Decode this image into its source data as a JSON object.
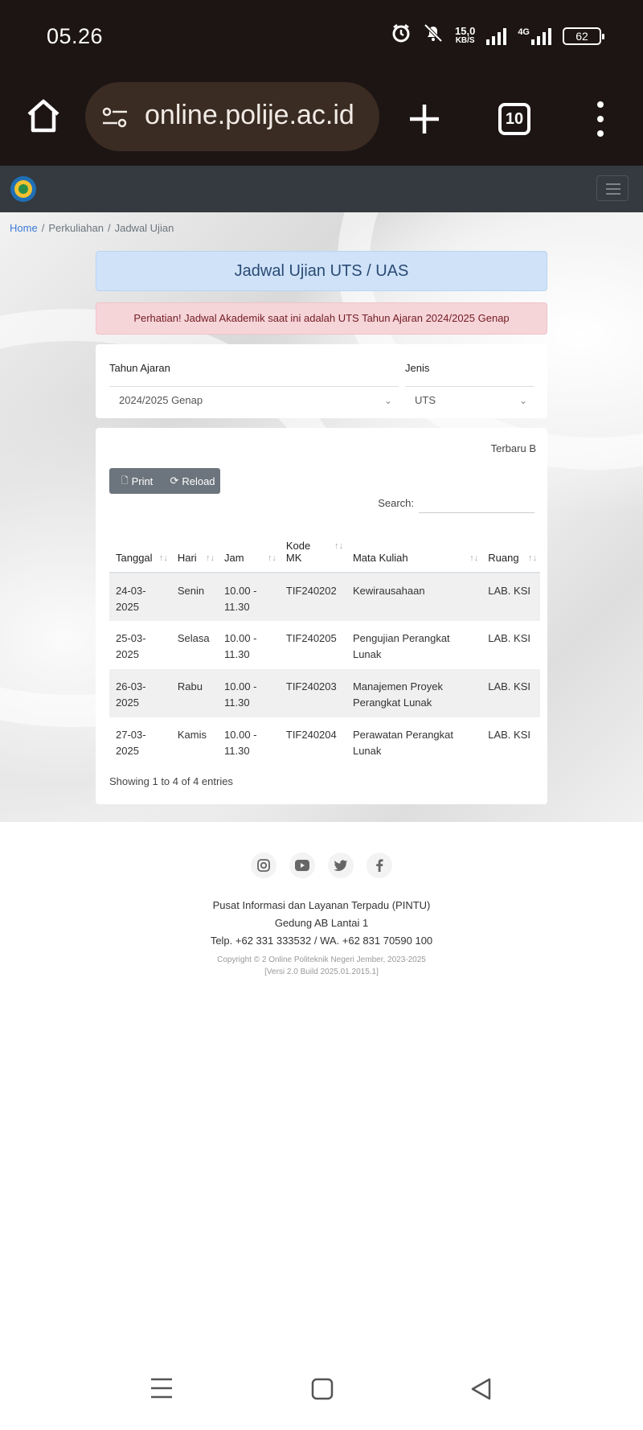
{
  "status_bar": {
    "time": "05.26",
    "net_speed_value": "15,0",
    "net_speed_unit": "KB/S",
    "network_type": "4G",
    "battery": "62"
  },
  "browser": {
    "url": "online.polije.ac.id",
    "tab_count": "10"
  },
  "breadcrumb": {
    "home": "Home",
    "section": "Perkuliahan",
    "current": "Jadwal Ujian"
  },
  "page": {
    "title": "Jadwal Ujian UTS / UAS",
    "alert": "Perhatian! Jadwal Akademik saat ini adalah UTS Tahun Ajaran 2024/2025 Genap"
  },
  "filters": {
    "tahun_label": "Tahun Ajaran",
    "tahun_value": "2024/2025 Genap",
    "jenis_label": "Jenis",
    "jenis_value": "UTS"
  },
  "table": {
    "last_update": "Terbaru B",
    "print_label": "Print",
    "reload_label": "Reload",
    "search_label": "Search:",
    "columns": [
      "Tanggal",
      "Hari",
      "Jam",
      "Kode MK",
      "Mata Kuliah",
      "Ruang"
    ],
    "rows": [
      {
        "tanggal": "24-03-2025",
        "hari": "Senin",
        "jam": "10.00 - 11.30",
        "kode": "TIF240202",
        "matkul": "Kewirausahaan",
        "ruang": "LAB. KSI"
      },
      {
        "tanggal": "25-03-2025",
        "hari": "Selasa",
        "jam": "10.00 - 11.30",
        "kode": "TIF240205",
        "matkul": "Pengujian Perangkat Lunak",
        "ruang": "LAB. KSI"
      },
      {
        "tanggal": "26-03-2025",
        "hari": "Rabu",
        "jam": "10.00 - 11.30",
        "kode": "TIF240203",
        "matkul": "Manajemen Proyek Perangkat Lunak",
        "ruang": "LAB. KSI"
      },
      {
        "tanggal": "27-03-2025",
        "hari": "Kamis",
        "jam": "10.00 - 11.30",
        "kode": "TIF240204",
        "matkul": "Perawatan Perangkat Lunak",
        "ruang": "LAB. KSI"
      }
    ],
    "showing": "Showing 1 to 4 of 4 entries"
  },
  "footer": {
    "line1": "Pusat Informasi dan Layanan Terpadu (PINTU)",
    "line2": "Gedung AB Lantai 1",
    "line3": "Telp. +62 331 333532 / WA. +62 831 70590 100",
    "copyright": "Copyright © 2 Online Politeknik Negeri Jember, 2023-2025",
    "version": "[Versi 2.0 Build 2025.01.2015.1]"
  }
}
